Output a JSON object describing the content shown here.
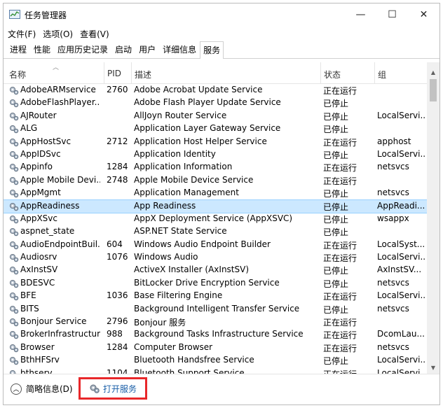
{
  "window": {
    "title": "任务管理器",
    "minimize": "—",
    "maximize": "☐",
    "close": "✕"
  },
  "menu": [
    "文件(F)",
    "选项(O)",
    "查看(V)"
  ],
  "tabs": [
    "进程",
    "性能",
    "应用历史记录",
    "启动",
    "用户",
    "详细信息",
    "服务"
  ],
  "active_tab": 6,
  "columns": {
    "name": "名称",
    "pid": "PID",
    "desc": "描述",
    "status": "状态",
    "group": "组"
  },
  "rows": [
    {
      "name": "AdobeARMservice",
      "pid": "2760",
      "desc": "Adobe Acrobat Update Service",
      "status": "正在运行",
      "group": ""
    },
    {
      "name": "AdobeFlashPlayer...",
      "pid": "",
      "desc": "Adobe Flash Player Update Service",
      "status": "已停止",
      "group": ""
    },
    {
      "name": "AJRouter",
      "pid": "",
      "desc": "AllJoyn Router Service",
      "status": "已停止",
      "group": "LocalServi..."
    },
    {
      "name": "ALG",
      "pid": "",
      "desc": "Application Layer Gateway Service",
      "status": "已停止",
      "group": ""
    },
    {
      "name": "AppHostSvc",
      "pid": "2712",
      "desc": "Application Host Helper Service",
      "status": "正在运行",
      "group": "apphost"
    },
    {
      "name": "AppIDSvc",
      "pid": "",
      "desc": "Application Identity",
      "status": "已停止",
      "group": "LocalServi..."
    },
    {
      "name": "Appinfo",
      "pid": "1284",
      "desc": "Application Information",
      "status": "正在运行",
      "group": "netsvcs"
    },
    {
      "name": "Apple Mobile Devi...",
      "pid": "2748",
      "desc": "Apple Mobile Device Service",
      "status": "正在运行",
      "group": ""
    },
    {
      "name": "AppMgmt",
      "pid": "",
      "desc": "Application Management",
      "status": "已停止",
      "group": "netsvcs"
    },
    {
      "name": "AppReadiness",
      "pid": "",
      "desc": "App Readiness",
      "status": "已停止",
      "group": "AppReadi..."
    },
    {
      "name": "AppXSvc",
      "pid": "",
      "desc": "AppX Deployment Service (AppXSVC)",
      "status": "已停止",
      "group": "wsappx"
    },
    {
      "name": "aspnet_state",
      "pid": "",
      "desc": "ASP.NET State Service",
      "status": "已停止",
      "group": ""
    },
    {
      "name": "AudioEndpointBuil...",
      "pid": "604",
      "desc": "Windows Audio Endpoint Builder",
      "status": "正在运行",
      "group": "LocalSyst..."
    },
    {
      "name": "Audiosrv",
      "pid": "1076",
      "desc": "Windows Audio",
      "status": "正在运行",
      "group": "LocalServi..."
    },
    {
      "name": "AxInstSV",
      "pid": "",
      "desc": "ActiveX Installer (AxInstSV)",
      "status": "已停止",
      "group": "AxInstSV..."
    },
    {
      "name": "BDESVC",
      "pid": "",
      "desc": "BitLocker Drive Encryption Service",
      "status": "已停止",
      "group": "netsvcs"
    },
    {
      "name": "BFE",
      "pid": "1036",
      "desc": "Base Filtering Engine",
      "status": "正在运行",
      "group": "LocalServi..."
    },
    {
      "name": "BITS",
      "pid": "",
      "desc": "Background Intelligent Transfer Service",
      "status": "已停止",
      "group": "netsvcs"
    },
    {
      "name": "Bonjour Service",
      "pid": "2796",
      "desc": "Bonjour 服务",
      "status": "正在运行",
      "group": ""
    },
    {
      "name": "BrokerInfrastructure",
      "pid": "988",
      "desc": "Background Tasks Infrastructure Service",
      "status": "正在运行",
      "group": "DcomLau..."
    },
    {
      "name": "Browser",
      "pid": "1284",
      "desc": "Computer Browser",
      "status": "正在运行",
      "group": "netsvcs"
    },
    {
      "name": "BthHFSrv",
      "pid": "",
      "desc": "Bluetooth Handsfree Service",
      "status": "已停止",
      "group": "LocalServi..."
    },
    {
      "name": "bthserv",
      "pid": "1104",
      "desc": "Bluetooth Support Service",
      "status": "正在运行",
      "group": "LocalServi..."
    }
  ],
  "selected_row": 9,
  "footer": {
    "brief": "简略信息(D)",
    "open": "打开服务"
  },
  "colors": {
    "selection": "#cce8ff",
    "highlight_box": "#e8272a",
    "link": "#1a5fa8"
  }
}
